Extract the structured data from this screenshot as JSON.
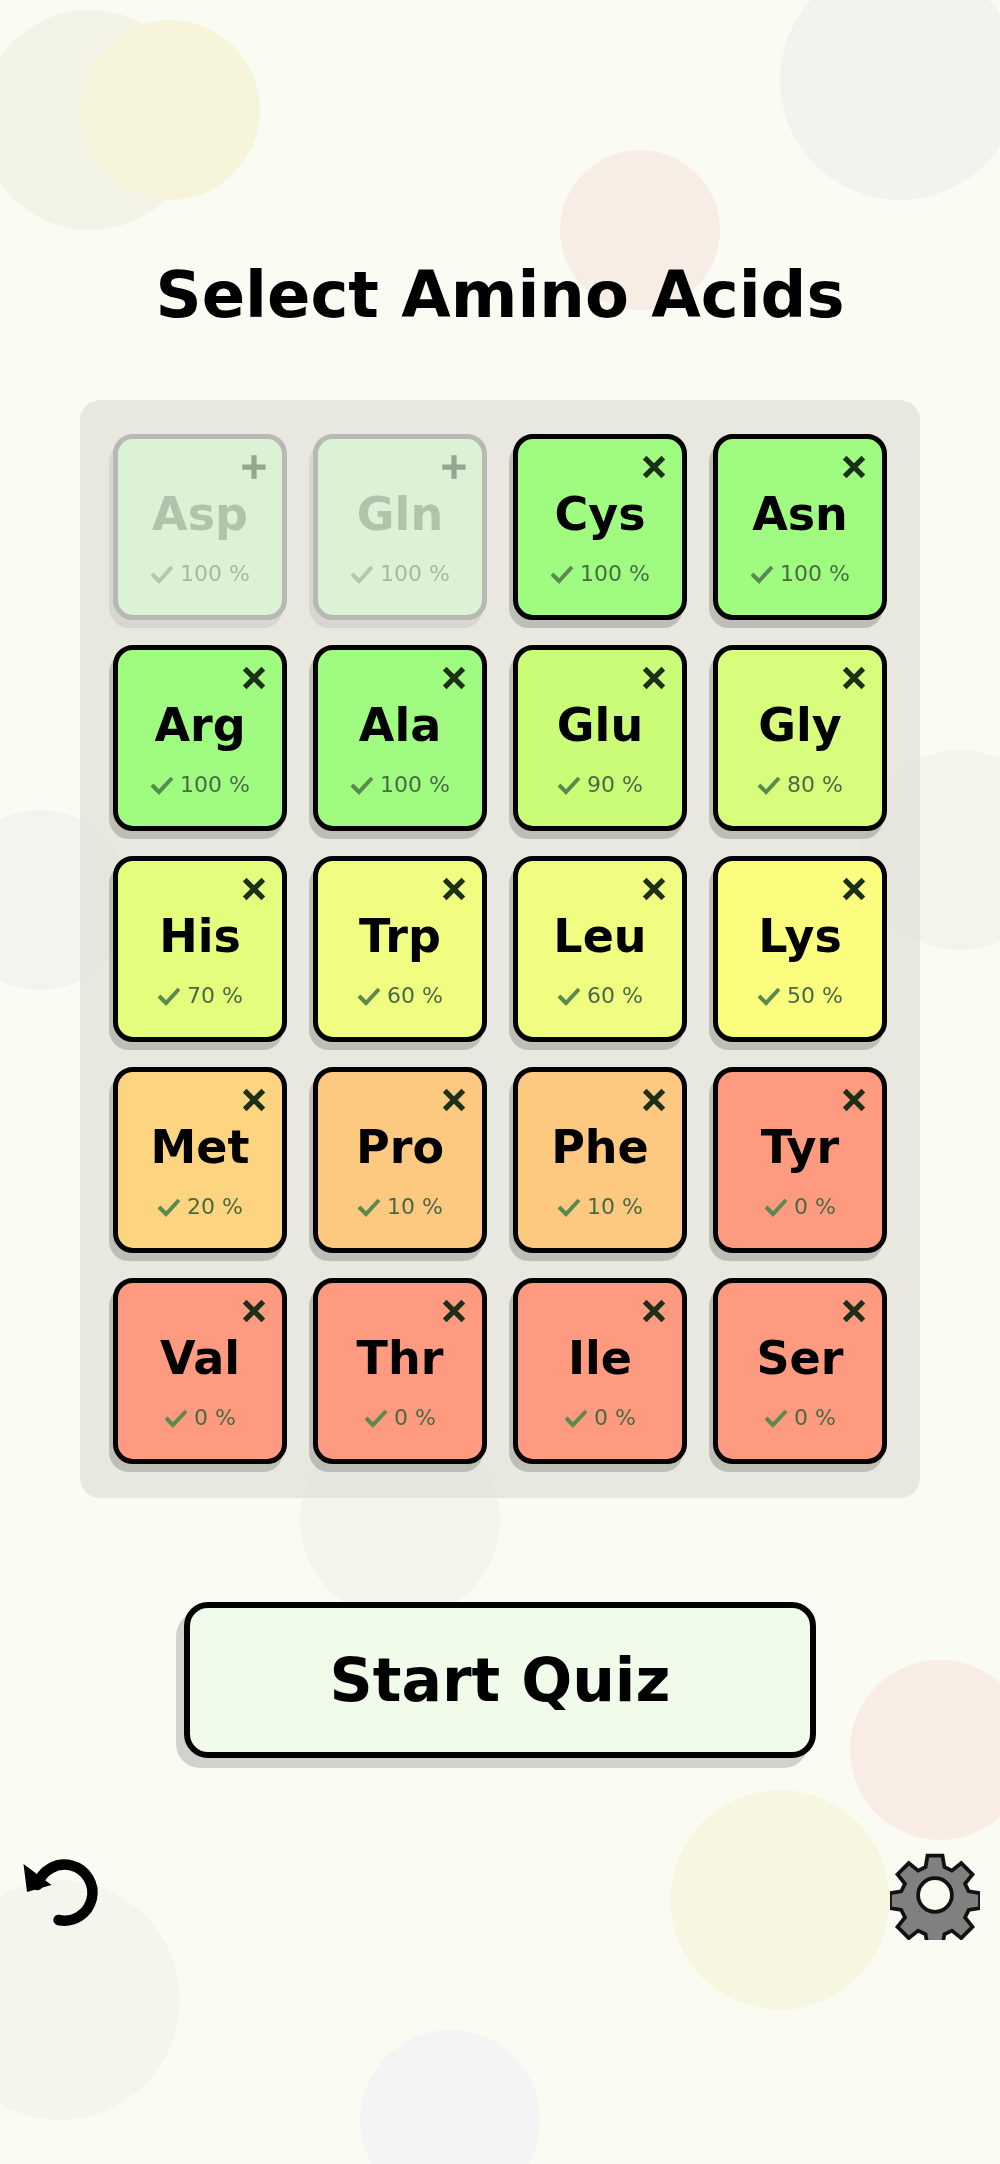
{
  "title": "Select Amino Acids",
  "tiles": [
    {
      "name": "Asp",
      "score": "100 %",
      "selected": false,
      "color": "#dcf2d4"
    },
    {
      "name": "Gln",
      "score": "100 %",
      "selected": false,
      "color": "#dcf2d4"
    },
    {
      "name": "Cys",
      "score": "100 %",
      "selected": true,
      "color": "#a0fc80"
    },
    {
      "name": "Asn",
      "score": "100 %",
      "selected": true,
      "color": "#a0fc80"
    },
    {
      "name": "Arg",
      "score": "100 %",
      "selected": true,
      "color": "#a0fc80"
    },
    {
      "name": "Ala",
      "score": "100 %",
      "selected": true,
      "color": "#a0fc80"
    },
    {
      "name": "Glu",
      "score": "90 %",
      "selected": true,
      "color": "#cafc78"
    },
    {
      "name": "Gly",
      "score": "80 %",
      "selected": true,
      "color": "#d8fc7c"
    },
    {
      "name": "His",
      "score": "70 %",
      "selected": true,
      "color": "#e4fd7c"
    },
    {
      "name": "Trp",
      "score": "60 %",
      "selected": true,
      "color": "#f0fd80"
    },
    {
      "name": "Leu",
      "score": "60 %",
      "selected": true,
      "color": "#f0fd80"
    },
    {
      "name": "Lys",
      "score": "50 %",
      "selected": true,
      "color": "#fbfd7e"
    },
    {
      "name": "Met",
      "score": "20 %",
      "selected": true,
      "color": "#fdd580"
    },
    {
      "name": "Pro",
      "score": "10 %",
      "selected": true,
      "color": "#fdc880"
    },
    {
      "name": "Phe",
      "score": "10 %",
      "selected": true,
      "color": "#fdc880"
    },
    {
      "name": "Tyr",
      "score": "0 %",
      "selected": true,
      "color": "#fd9a80"
    },
    {
      "name": "Val",
      "score": "0 %",
      "selected": true,
      "color": "#fd9a80"
    },
    {
      "name": "Thr",
      "score": "0 %",
      "selected": true,
      "color": "#fd9a80"
    },
    {
      "name": "Ile",
      "score": "0 %",
      "selected": true,
      "color": "#fd9a80"
    },
    {
      "name": "Ser",
      "score": "0 %",
      "selected": true,
      "color": "#fd9a80"
    }
  ],
  "start_button": "Start Quiz"
}
